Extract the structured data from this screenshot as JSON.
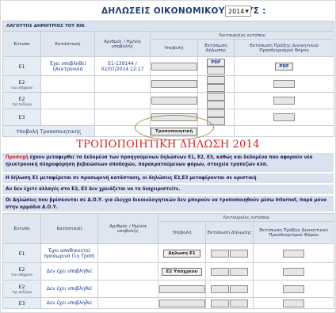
{
  "header": {
    "title": "ΔΗΛΩΣΕΙΣ ΟΙΚΟΝΟΜΙΚΟΥ ΕΤΟΥΣ :",
    "year": "2014"
  },
  "taxpayer": "ΛΑΓΟΥΤΗΣ ΔΗΜΗΤΡΙΟΣ ΤΟΥ ΝΙΚ",
  "table1": {
    "group_header": "Λειτουργίες εντύπου",
    "col_form": "Εντυπο",
    "col_status": "Κατάσταση",
    "col_number": "Αριθμός / Ημ/νία υποβολής",
    "col_submit": "Υποβολή",
    "col_print_decl": "Εκτύπωση Δήλωσης",
    "col_print_act": "Εκτύπωση Πράξης Διοικητικού Προσδιορισμού Φόρου",
    "pdf": "PDF",
    "rows": [
      {
        "form": "E1",
        "sub": "",
        "status": "Έχει υποβληθεί ηλεκτρονικά",
        "number": "E1-139144 /",
        "date": "02/07/2014 12:17"
      },
      {
        "form": "E2",
        "sub": "του υπόχρεου",
        "status": "",
        "number": "",
        "date": ""
      },
      {
        "form": "E2",
        "sub": "της συζύγου",
        "status": "",
        "number": "",
        "date": ""
      },
      {
        "form": "E3",
        "sub": "",
        "status": "",
        "number": "",
        "date": ""
      }
    ],
    "amend_label": "Υποβολή Τροποποιητικής",
    "amend_button": "Τροποποιητική"
  },
  "red_title": "ΤΡΟΠΟΠΟΙΗΤΙΚΗ ΔΗΛΩΣΗ 2014",
  "notes": {
    "n1_warn": "Προσοχή",
    "n1_text": " έχουν μεταφερθεί τα δεδομένα των προηγούμενων δηλώσεων Ε1, Ε2, Ε3, καθώς και δεδομένα που αφορούν νέα ηλεκτρονική πληροφόρηση βεβαιώσεων αποδοχών, παρακρατούμενων φόρων, στοιχεία τραπεζών κλπ.",
    "n2": "Η δήλωση Ε1 μεταφέρεται σε προσωρινή κατάσταση, οι δηλώσεις Ε2,Ε3 μεταφέρονται σε οριστική",
    "n3": "Αν δεν έχετε αλλαγές στο Ε2, Ε3 δεν χρειάζεται να τα διαχειριστείτε.",
    "n4": "Οι Δηλώσεις που βρίσκονται σε Δ.Ο.Υ. για έλεγχο δικαιολογητικών δεν μπορούν να τροποποιηθούν μέσω Internet, παρά μόνο στην αρμόδια Δ.Ο.Υ."
  },
  "table2": {
    "group_header": "Λειτουργίες εντύπου",
    "col_form": "Εντυπο",
    "col_status": "Κατάσταση",
    "col_number": "Αριθμός / Ημ/νία υποβολής",
    "col_submit": "Υποβολή",
    "col_print_decl": "Εκτύπωση Δήλωσης",
    "col_print_act": "Εκτύπωση Πράξης Διοικητικού Προσδιορισμού Φόρου",
    "rows": [
      {
        "form": "E1",
        "sub": "",
        "status": "Έχει αποθηκευτεί προσωρινά (1η Τροπ)",
        "button": "Δήλωση Ε1"
      },
      {
        "form": "E2",
        "sub": "του υπόχρεου",
        "status": "Δεν έχει υποβληθεί",
        "button": "Ε2 Υπόχρεου"
      },
      {
        "form": "E2",
        "sub": "της συζύγου",
        "status": "Δεν έχει υποβληθεί",
        "button": ""
      },
      {
        "form": "E3",
        "sub": "",
        "status": "Δεν έχει υποβληθεί",
        "button": ""
      }
    ]
  }
}
